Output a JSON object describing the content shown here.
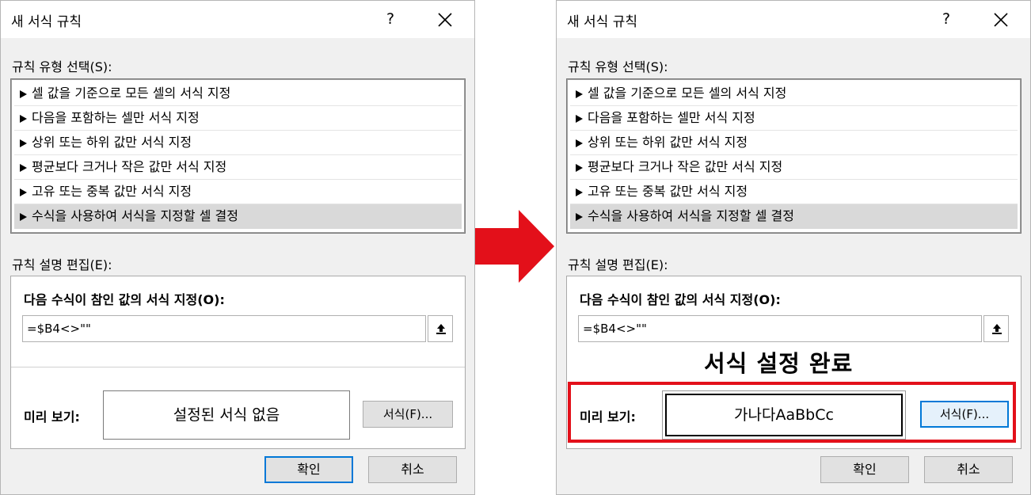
{
  "dialogs": [
    {
      "title": "새 서식 규칙",
      "help": "?",
      "rule_type_label": "규칙 유형 선택(S):",
      "rules": [
        "셀 값을 기준으로 모든 셀의 서식 지정",
        "다음을 포함하는 셀만 서식 지정",
        "상위 또는 하위 값만 서식 지정",
        "평균보다 크거나 작은 값만 서식 지정",
        "고유 또는 중복 값만 서식 지정",
        "수식을 사용하여 서식을 지정할 셀 결정"
      ],
      "selected_rule": 5,
      "edit_label": "규칙 설명 편집(E):",
      "formula_label": "다음 수식이 참인 값의 서식 지정(O):",
      "formula_value": "=$B4<>\"\"",
      "preview_label": "미리 보기:",
      "preview_text": "설정된 서식 없음",
      "format_button": "서식(F)...",
      "ok_button": "확인",
      "cancel_button": "취소"
    },
    {
      "title": "새 서식 규칙",
      "help": "?",
      "rule_type_label": "규칙 유형 선택(S):",
      "rules": [
        "셀 값을 기준으로 모든 셀의 서식 지정",
        "다음을 포함하는 셀만 서식 지정",
        "상위 또는 하위 값만 서식 지정",
        "평균보다 크거나 작은 값만 서식 지정",
        "고유 또는 중복 값만 서식 지정",
        "수식을 사용하여 서식을 지정할 셀 결정"
      ],
      "selected_rule": 5,
      "edit_label": "규칙 설명 편집(E):",
      "formula_label": "다음 수식이 참인 값의 서식 지정(O):",
      "formula_value": "=$B4<>\"\"",
      "preview_label": "미리 보기:",
      "preview_text": "가나다AaBbCc",
      "format_button": "서식(F)...",
      "ok_button": "확인",
      "cancel_button": "취소"
    }
  ],
  "callout": "서식 설정 완료",
  "colors": {
    "arrow": "#e3101a",
    "highlight": "#e3101a",
    "focus": "#0078d7"
  },
  "icons": [
    "close-icon",
    "collapse-dialog-icon",
    "right-arrow-icon",
    "triangle-right-icon"
  ]
}
